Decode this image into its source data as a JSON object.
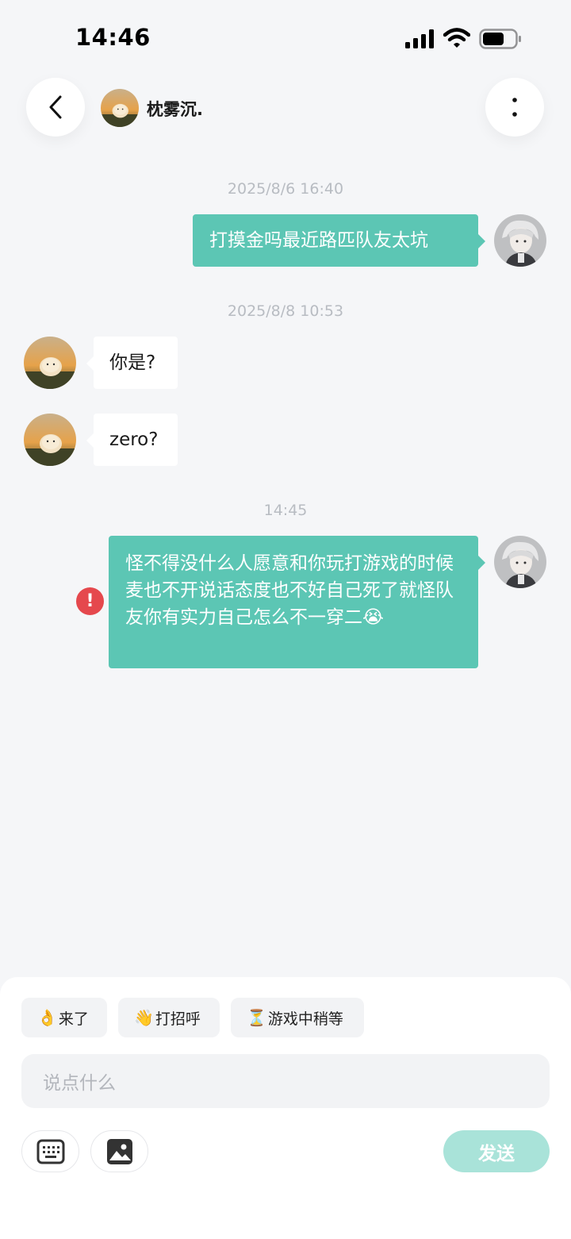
{
  "status_bar": {
    "time": "14:46"
  },
  "header": {
    "contact_name": "枕雾沉."
  },
  "messages": [
    {
      "timestamp": "2025/8/6 16:40",
      "text": "打摸金吗最近路匹队友太坑"
    },
    {
      "timestamp": "2025/8/8 10:53",
      "text": "你是?"
    },
    {
      "text": "zero?"
    },
    {
      "timestamp": "14:45",
      "text": "怪不得没什么人愿意和你玩打游戏的时候麦也不开说话态度也不好自己死了就怪队友你有实力自己怎么不一穿二",
      "emoji": "😭",
      "error_mark": "!"
    }
  ],
  "quick_replies": [
    {
      "emoji": "👌",
      "label": "来了"
    },
    {
      "emoji": "👋",
      "label": "打招呼"
    },
    {
      "emoji": "⏳",
      "label": "游戏中稍等"
    }
  ],
  "composer": {
    "placeholder": "说点什么",
    "send_label": "发送"
  },
  "icons": {
    "keyboard": "keyboard-icon",
    "image": "image-icon",
    "back": "chevron-left-icon",
    "more": "more-vertical-icon"
  },
  "colors": {
    "outgoing_bubble": "#5cc6b4",
    "send_button": "#a9e3d9",
    "error": "#e5484d"
  }
}
